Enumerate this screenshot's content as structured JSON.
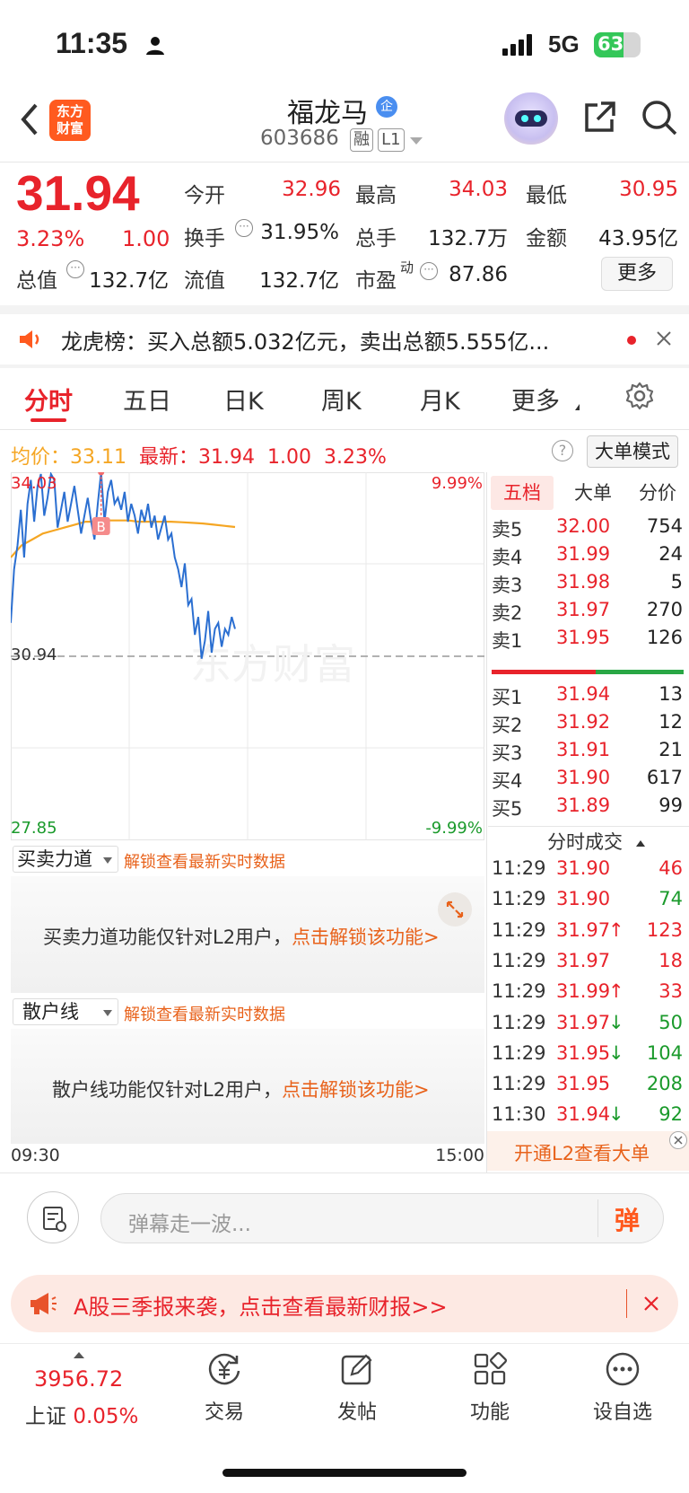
{
  "status": {
    "time": "11:35",
    "network": "5G",
    "battery": "63"
  },
  "header": {
    "stock_name": "福龙马",
    "badge": "企",
    "code": "603686",
    "tag1": "融",
    "tag2": "L1"
  },
  "quote": {
    "price": "31.94",
    "change_pct": "3.23%",
    "change": "1.00",
    "labels": {
      "open": "今开",
      "high": "最高",
      "low": "最低",
      "turnover": "换手",
      "volume": "总手",
      "amount": "金额",
      "mktcap": "总值",
      "float": "流值",
      "pe": "市盈",
      "pe_sup": "动"
    },
    "open": "32.96",
    "high": "34.03",
    "low": "30.95",
    "turnover": "31.95%",
    "volume": "132.7万",
    "amount": "43.95亿",
    "mktcap": "132.7亿",
    "float": "132.7亿",
    "pe": "87.86",
    "more": "更多"
  },
  "notice": {
    "text": "龙虎榜：买入总额5.032亿元，卖出总额5.555亿..."
  },
  "tabs": [
    "分时",
    "五日",
    "日K",
    "周K",
    "月K",
    "更多"
  ],
  "chart_info": {
    "avg_label": "均价：",
    "avg": "33.11",
    "latest_label": "最新：",
    "latest": "31.94",
    "change": "1.00",
    "change_pct": "3.23%",
    "mode": "大单模式"
  },
  "chart_data": {
    "type": "line",
    "y_top": "34.03",
    "y_mid": "30.94",
    "y_bottom": "27.85",
    "pct_top": "9.99%",
    "pct_bottom": "-9.99%",
    "x_start": "09:30",
    "x_end": "15:00",
    "ylim": [
      27.85,
      34.03
    ],
    "marker": "B",
    "watermark": "东方财富",
    "series": [
      {
        "values": [
          31.5,
          32.4,
          32.8,
          33.4,
          32.6,
          33.5,
          33.9,
          33.2,
          33.8,
          34.0,
          33.3,
          33.6,
          34.0,
          33.9,
          33.1,
          33.4,
          33.7,
          33.2,
          33.5,
          33.8,
          33.4,
          33.0,
          33.3,
          33.6,
          33.2,
          32.9,
          33.5,
          34.03,
          33.2,
          33.7,
          33.9,
          33.5,
          33.6,
          33.4,
          33.7,
          33.2,
          33.5,
          33.3,
          33.0,
          33.4,
          33.2,
          33.5,
          33.1,
          33.3,
          32.9,
          33.1,
          33.3,
          32.9,
          33.0,
          32.6,
          32.4,
          32.1,
          32.5,
          31.8,
          31.9,
          31.3,
          31.6,
          30.9,
          31.2,
          31.7,
          31.0,
          31.4,
          31.5,
          31.1,
          31.4,
          31.3,
          31.6,
          31.4
        ],
        "color": "#2b6fd1"
      },
      {
        "values": [
          32.6,
          32.8,
          32.9,
          33.0,
          33.05,
          33.1,
          33.15,
          33.2,
          33.2,
          33.22,
          33.22,
          33.22,
          33.2,
          33.2,
          33.2,
          33.2,
          33.19,
          33.18,
          33.17,
          33.15,
          33.13,
          33.11
        ],
        "color": "#f5a623"
      }
    ]
  },
  "orderbook": {
    "tabs": [
      "五档",
      "大单",
      "分价"
    ],
    "asks": [
      {
        "label": "卖5",
        "price": "32.00",
        "vol": "754"
      },
      {
        "label": "卖4",
        "price": "31.99",
        "vol": "24"
      },
      {
        "label": "卖3",
        "price": "31.98",
        "vol": "5"
      },
      {
        "label": "卖2",
        "price": "31.97",
        "vol": "270"
      },
      {
        "label": "卖1",
        "price": "31.95",
        "vol": "126"
      }
    ],
    "bids": [
      {
        "label": "买1",
        "price": "31.94",
        "vol": "13"
      },
      {
        "label": "买2",
        "price": "31.92",
        "vol": "12"
      },
      {
        "label": "买3",
        "price": "31.91",
        "vol": "21"
      },
      {
        "label": "买4",
        "price": "31.90",
        "vol": "617"
      },
      {
        "label": "买5",
        "price": "31.89",
        "vol": "99"
      }
    ],
    "trades_title": "分时成交",
    "trades": [
      {
        "time": "11:29",
        "price": "31.90",
        "arrow": "",
        "vol": "46",
        "dir": "sell"
      },
      {
        "time": "11:29",
        "price": "31.90",
        "arrow": "",
        "vol": "74",
        "dir": "buy"
      },
      {
        "time": "11:29",
        "price": "31.97",
        "arrow": "↑",
        "vol": "123",
        "dir": "sell"
      },
      {
        "time": "11:29",
        "price": "31.97",
        "arrow": "",
        "vol": "18",
        "dir": "sell"
      },
      {
        "time": "11:29",
        "price": "31.99",
        "arrow": "↑",
        "vol": "33",
        "dir": "sell"
      },
      {
        "time": "11:29",
        "price": "31.97",
        "arrow": "↓",
        "vol": "50",
        "dir": "buy"
      },
      {
        "time": "11:29",
        "price": "31.95",
        "arrow": "↓",
        "vol": "104",
        "dir": "buy"
      },
      {
        "time": "11:29",
        "price": "31.95",
        "arrow": "",
        "vol": "208",
        "dir": "buy"
      },
      {
        "time": "11:30",
        "price": "31.94",
        "arrow": "↓",
        "vol": "92",
        "dir": "buy"
      }
    ],
    "l2_banner": "开通L2查看大单"
  },
  "panels": {
    "power_label": "买卖力道",
    "power_unlock": "解锁查看最新实时数据",
    "power_msg": "买卖力道功能仅针对L2用户，",
    "power_link": "点击解锁该功能>",
    "retail_label": "散户线",
    "retail_unlock": "解锁查看最新实时数据",
    "retail_msg": "散户线功能仅针对L2用户，",
    "retail_link": "点击解锁该功能>"
  },
  "comment": {
    "placeholder": "弹幕走一波...",
    "bullet": "弹"
  },
  "promo": {
    "text": "A股三季报来袭，点击查看最新财报>>"
  },
  "nav": {
    "index_value": "3956.72",
    "index_name": "上证",
    "index_change": "0.05%",
    "items": [
      "交易",
      "发帖",
      "功能",
      "设自选"
    ]
  }
}
